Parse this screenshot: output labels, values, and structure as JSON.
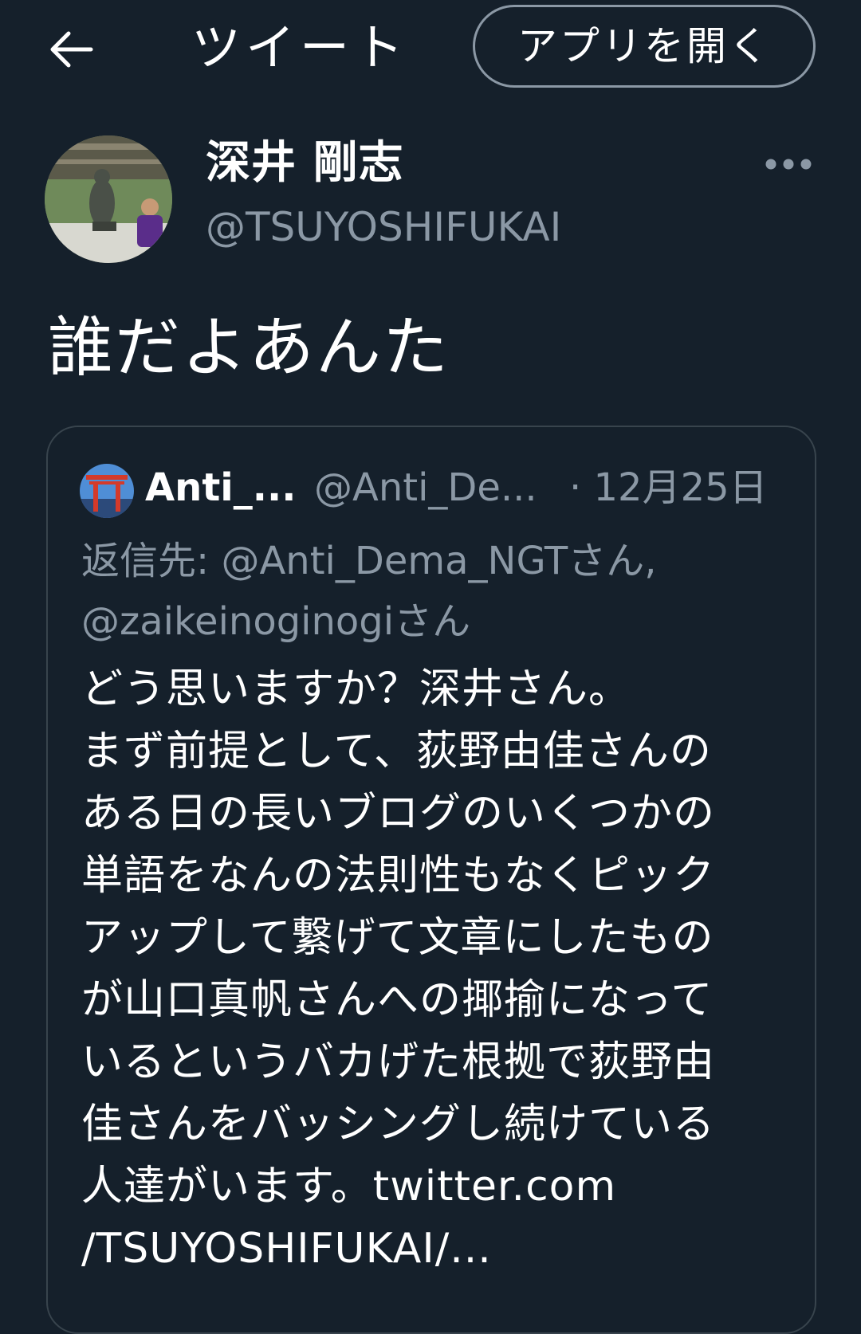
{
  "header": {
    "title": "ツイート",
    "open_app_label": "アプリを開く"
  },
  "author": {
    "name": "深井 剛志",
    "handle": "@TSUYOSHIFUKAI"
  },
  "tweet": {
    "text": "誰だよあんた"
  },
  "quoted_tweet": {
    "author_name": "Anti_...",
    "author_handle": "@Anti_De...",
    "date": "· 12月25日",
    "reply_prefix": "返信先:",
    "reply_line1_mention": "@Anti_Dema_NGTさん,",
    "reply_line2_mention": "@zaikeinoginogiさん",
    "body_lines": [
      "どう思いますか？深井さん。",
      "まず前提として、荻野由佳さんの",
      "ある日の長いブログのいくつかの",
      "単語をなんの法則性もなくピック",
      "アップして繋げて文章にしたもの",
      "が山口真帆さんへの揶揄になって",
      "いるというバカげた根拠で荻野由",
      "佳さんをバッシングし続けている",
      "人達がいます。twitter.com",
      "/TSUYOSHIFUKAI/..."
    ]
  },
  "icons": {
    "back": "back-arrow-icon",
    "more": "more-horizontal-icon"
  },
  "colors": {
    "background": "#15202b",
    "secondary_text": "#8b98a5",
    "border": "#38444d"
  }
}
